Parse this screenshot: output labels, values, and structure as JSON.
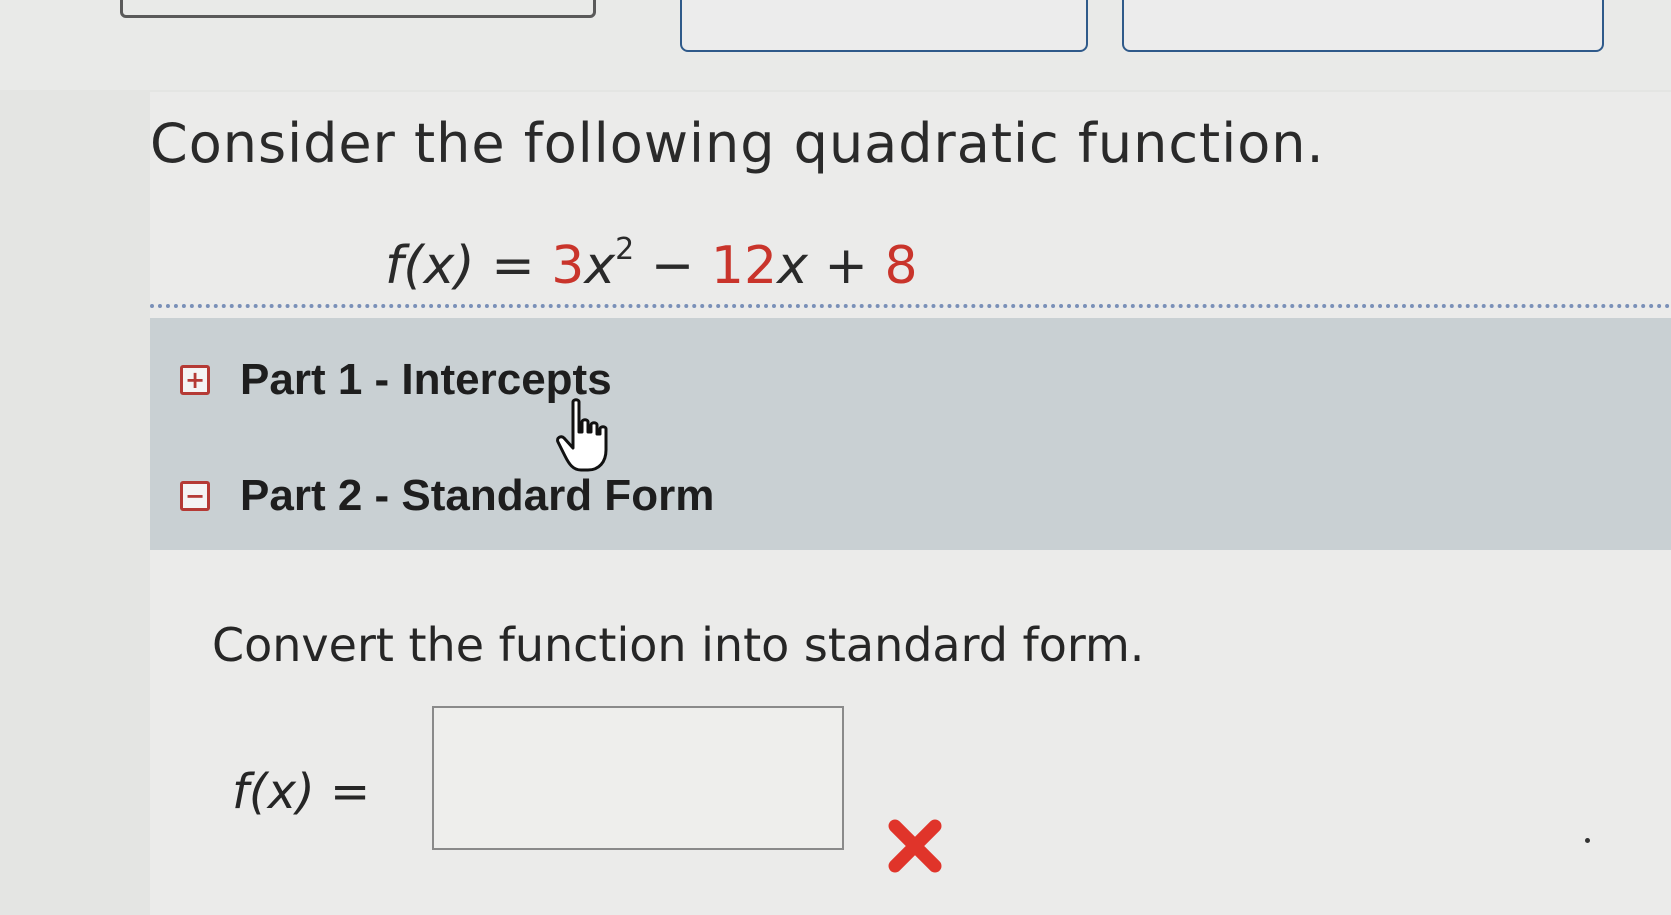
{
  "question": {
    "prompt": "Consider the following quadratic function.",
    "function": {
      "lhs": "f(x)",
      "equals": "=",
      "term1_coef": "3",
      "term1_var": "x",
      "term1_exp": "2",
      "op1": "−",
      "term2_coef": "12",
      "term2_var": "x",
      "op2": "+",
      "term3": "8"
    }
  },
  "parts": [
    {
      "label": "Part 1 - Intercepts",
      "toggle": "+",
      "state": "collapsed"
    },
    {
      "label": "Part 2 - Standard Form",
      "toggle": "−",
      "state": "expanded"
    }
  ],
  "part2": {
    "instruction": "Convert the function into standard form.",
    "answer_label_fn": "f(x)",
    "answer_label_eq": "=",
    "answer_value": "",
    "result_icon": "incorrect-x-icon"
  },
  "colors": {
    "accent_red": "#c9342b",
    "toggle_border": "#b53a35",
    "accordion_bg": "#c9d0d3",
    "divider": "#7a90b8",
    "top_button_border": "#2f5a8a"
  }
}
